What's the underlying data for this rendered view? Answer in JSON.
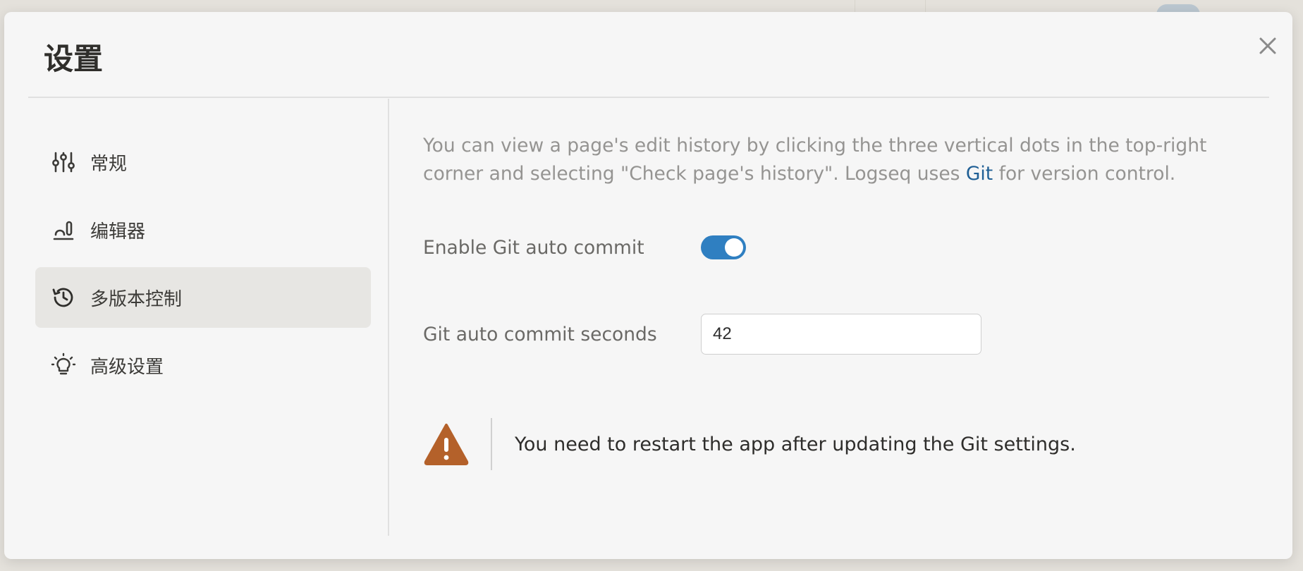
{
  "modal": {
    "title": "设置",
    "close_icon": "close-icon"
  },
  "sidebar": {
    "items": [
      {
        "label": "常规",
        "icon": "sliders-icon",
        "active": false
      },
      {
        "label": "编辑器",
        "icon": "editor-icon",
        "active": false
      },
      {
        "label": "多版本控制",
        "icon": "history-icon",
        "active": true
      },
      {
        "label": "高级设置",
        "icon": "lightbulb-icon",
        "active": false
      }
    ]
  },
  "main": {
    "description_prefix": "You can view a page's edit history by clicking the three vertical dots in the top-right corner and selecting \"Check page's history\". Logseq uses ",
    "git_link": "Git",
    "description_suffix": " for version control.",
    "auto_commit": {
      "label": "Enable Git auto commit",
      "enabled": true
    },
    "commit_seconds": {
      "label": "Git auto commit seconds",
      "value": "42"
    },
    "notice": {
      "icon": "warning-icon",
      "text": "You need to restart the app after updating the Git settings."
    }
  },
  "colors": {
    "accent": "#2f7fc1",
    "link": "#1f5f95",
    "warning": "#b4612a",
    "active_bg": "#e7e6e3"
  }
}
